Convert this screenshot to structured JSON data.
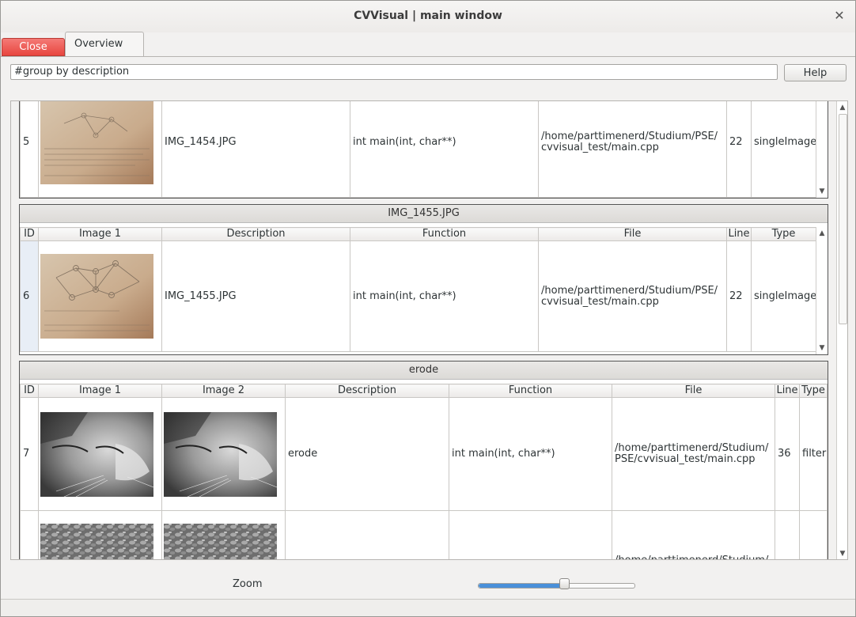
{
  "window": {
    "title": "CVVisual | main window",
    "close_glyph": "✕"
  },
  "tabs": {
    "close_label": "Close",
    "overview_label": "Overview"
  },
  "filter": {
    "value": "#group by description",
    "help_label": "Help"
  },
  "zoom": {
    "label": "Zoom",
    "level": 0.56
  },
  "groups": [
    {
      "header": "",
      "rows": [
        {
          "id": "5",
          "image": "doc-photo",
          "description": "IMG_1454.JPG",
          "function": "int main(int, char**)",
          "file": "/home/parttimenerd/Studium/PSE/ cvvisual_test/main.cpp",
          "line": "22",
          "type": "singleImage"
        }
      ]
    },
    {
      "header": "IMG_1455.JPG",
      "columns": [
        "ID",
        "Image 1",
        "Description",
        "Function",
        "File",
        "Line",
        "Type"
      ],
      "rows": [
        {
          "id": "6",
          "image": "doc-photo",
          "description": "IMG_1455.JPG",
          "function": "int main(int, char**)",
          "file": "/home/parttimenerd/Studium/PSE/ cvvisual_test/main.cpp",
          "line": "22",
          "type": "singleImage"
        }
      ]
    },
    {
      "header": "erode",
      "columns": [
        "ID",
        "Image 1",
        "Image 2",
        "Description",
        "Function",
        "File",
        "Line",
        "Type"
      ],
      "rows": [
        {
          "id": "7",
          "image1": "cat-photo",
          "image2": "cat-photo",
          "description": "erode",
          "function": "int main(int, char**)",
          "file": "/home/parttimenerd/Studium/ PSE/cvvisual_test/main.cpp",
          "line": "36",
          "type": "filter"
        },
        {
          "id": "",
          "image1": "texture-photo",
          "image2": "texture-photo",
          "description": "",
          "function": "",
          "file": "/home/parttimenerd/Studium/",
          "line": "",
          "type": ""
        }
      ]
    }
  ],
  "icons": {
    "up": "▲",
    "down": "▼"
  }
}
